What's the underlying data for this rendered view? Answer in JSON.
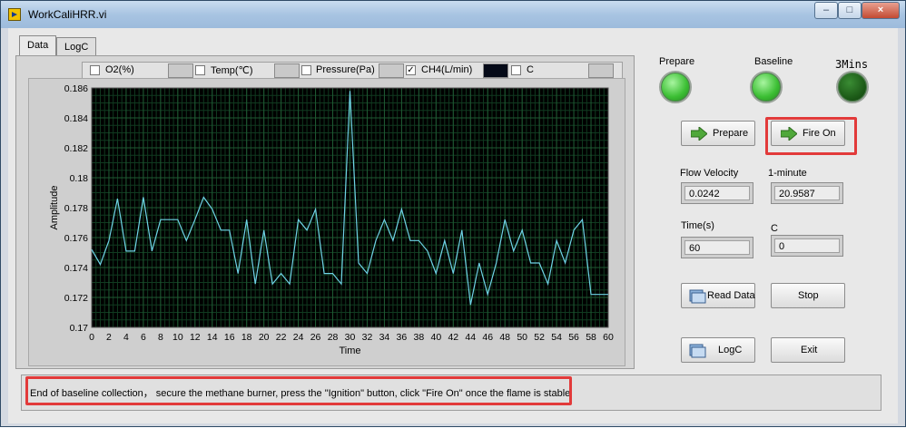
{
  "window": {
    "title": "WorkCaliHRR.vi",
    "minimize": "–",
    "maximize": "□",
    "close": "×"
  },
  "tabs": [
    {
      "label": "Data",
      "active": true
    },
    {
      "label": "LogC",
      "active": false
    }
  ],
  "legend": [
    {
      "label": "O2(%)",
      "checked": false
    },
    {
      "label": "Temp(℃)",
      "checked": false
    },
    {
      "label": "Pressure(Pa)",
      "checked": false
    },
    {
      "label": "CH4(L/min)",
      "checked": true,
      "check_mark": "✓"
    },
    {
      "label": "C",
      "checked": false
    }
  ],
  "indicators": {
    "prepare": {
      "label": "Prepare",
      "state": "on"
    },
    "baseline": {
      "label": "Baseline",
      "state": "on"
    },
    "three_mins": {
      "label": "3Mins",
      "state": "dark"
    }
  },
  "buttons": {
    "prepare": "Prepare",
    "fire_on": "Fire On",
    "read_data": "Read Data",
    "stop": "Stop",
    "logc": "LogC",
    "exit": "Exit"
  },
  "fields": {
    "flow_velocity": {
      "label": "Flow Velocity",
      "value": "0.0242"
    },
    "one_minute": {
      "label": "1-minute",
      "value": "20.9587"
    },
    "time": {
      "label": "Time(s)",
      "value": "60"
    },
    "c": {
      "label": "C",
      "value": "0"
    }
  },
  "status": {
    "message": "End of baseline collection， secure the methane burner, press the \"Ignition\" button, click \"Fire On\" once the flame is stable"
  },
  "colors": {
    "plot_bg": "#000000",
    "grid": "#1f5a33",
    "trace": "#6fd3e6",
    "highlight": "#e23a3a",
    "led_on": "#3cbf34"
  },
  "chart_data": {
    "type": "line",
    "xlabel": "Time",
    "ylabel": "Amplitude",
    "xlim": [
      0,
      60
    ],
    "ylim": [
      0.17,
      0.186
    ],
    "x_ticks": [
      0,
      2,
      4,
      6,
      8,
      10,
      12,
      14,
      16,
      18,
      20,
      22,
      24,
      26,
      28,
      30,
      32,
      34,
      36,
      38,
      40,
      42,
      44,
      46,
      48,
      50,
      52,
      54,
      56,
      58,
      60
    ],
    "y_ticks": [
      0.17,
      0.172,
      0.174,
      0.176,
      0.178,
      0.18,
      0.182,
      0.184,
      0.186
    ],
    "grid": true,
    "series": [
      {
        "name": "CH4(L/min)",
        "x": [
          0,
          1,
          2,
          3,
          4,
          5,
          6,
          7,
          8,
          9,
          10,
          11,
          12,
          13,
          14,
          15,
          16,
          17,
          18,
          19,
          20,
          21,
          22,
          23,
          24,
          25,
          26,
          27,
          28,
          29,
          30,
          31,
          32,
          33,
          34,
          35,
          36,
          37,
          38,
          39,
          40,
          41,
          42,
          43,
          44,
          45,
          46,
          47,
          48,
          49,
          50,
          51,
          52,
          53,
          54,
          55,
          56,
          57,
          58,
          59,
          60
        ],
        "values": [
          0.1752,
          0.1742,
          0.1758,
          0.1786,
          0.1751,
          0.1751,
          0.1787,
          0.1751,
          0.1772,
          0.1772,
          0.1772,
          0.1758,
          0.1772,
          0.1787,
          0.1779,
          0.1765,
          0.1765,
          0.1736,
          0.1772,
          0.1729,
          0.1765,
          0.1729,
          0.1736,
          0.1729,
          0.1772,
          0.1765,
          0.1779,
          0.1736,
          0.1736,
          0.1729,
          0.1858,
          0.1743,
          0.1736,
          0.1758,
          0.1772,
          0.1758,
          0.1779,
          0.1758,
          0.1758,
          0.1751,
          0.1736,
          0.1758,
          0.1736,
          0.1765,
          0.1715,
          0.1743,
          0.1722,
          0.1743,
          0.1772,
          0.1751,
          0.1765,
          0.1743,
          0.1743,
          0.1729,
          0.1758,
          0.1743,
          0.1765,
          0.1772,
          0.1722,
          0.1722,
          0.1722
        ]
      }
    ]
  }
}
